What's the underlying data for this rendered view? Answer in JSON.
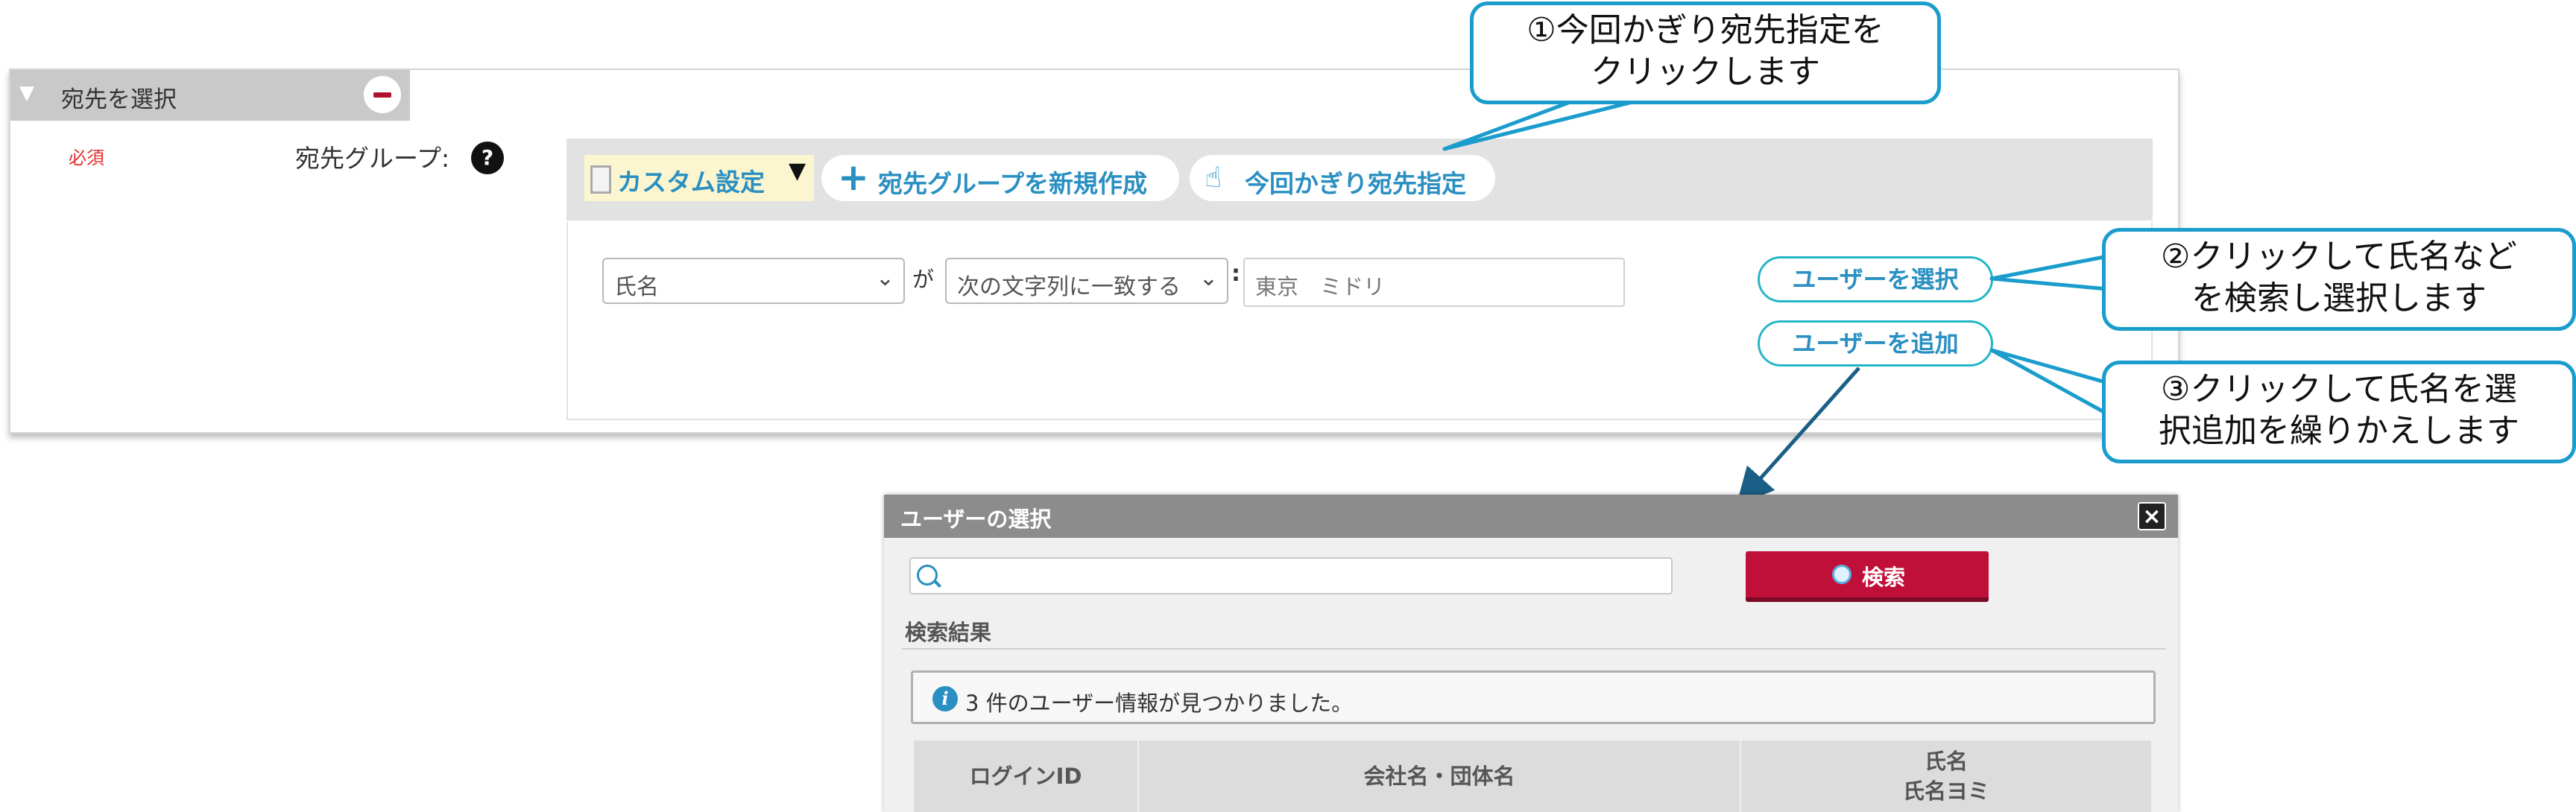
{
  "panel": {
    "title": "宛先を選択",
    "required_label": "必須",
    "group_label": "宛先グループ:",
    "help_symbol": "?"
  },
  "toolbar": {
    "custom_setting": "カスタム設定",
    "caret": "▼",
    "new_group": "宛先グループを新規作成",
    "one_time": "今回かぎり宛先指定"
  },
  "filter": {
    "field_value": "氏名",
    "connector": "が",
    "match_value": "次の文字列に一致する",
    "separator": ":",
    "text_value": "東京　ミドリ",
    "select_user": "ユーザーを選択",
    "add_user": "ユーザーを追加"
  },
  "callouts": {
    "c1_line1": "①今回かぎり宛先指定を",
    "c1_line2": "クリックします",
    "c2_line1": "②クリックして氏名など",
    "c2_line2": "を検索し選択します",
    "c3_line1": "③クリックして氏名を選",
    "c3_line2": "択追加を繰りかえします",
    "color": "#1a9ccc"
  },
  "dialog": {
    "title": "ユーザーの選択",
    "close_symbol": "×",
    "search_input_value": "",
    "search_button": "検索",
    "results_label": "検索結果",
    "info_message": "3 件のユーザー情報が見つかりました。",
    "columns": {
      "login_id": "ログインID",
      "company": "会社名・団体名",
      "name": "氏名",
      "name_reading": "氏名ヨミ"
    }
  },
  "colors": {
    "accent": "#2a8fc1",
    "search_button": "#c0103a",
    "required": "#e03030"
  }
}
